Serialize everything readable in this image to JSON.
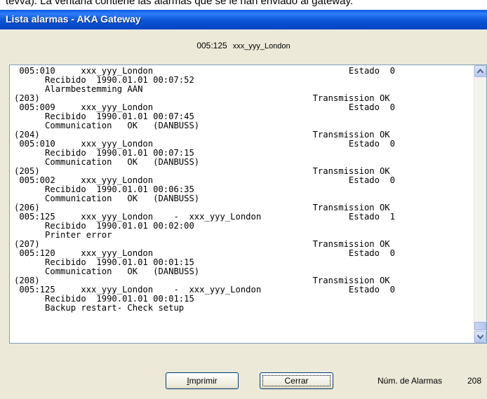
{
  "background_text": "tevva). La ventana contiene las alarmas que se le han enviado al gateway.",
  "window": {
    "title": "Lista alarmas - AKA Gateway"
  },
  "header": {
    "code": "005:125",
    "name": "xxx_yyy_London"
  },
  "alarm_lines": [
    " 005:010     xxx_yyy_London                                      Estado  0",
    "      Recibido  1990.01.01 00:07:52",
    "      Alarmbestemming AAN",
    "(203)                                                     Transmission OK",
    " 005:009     xxx_yyy_London                                      Estado  0",
    "      Recibido  1990.01.01 00:07:45",
    "      Communication   OK   (DANBUSS)",
    "(204)                                                     Transmission OK",
    " 005:010     xxx_yyy_London                                      Estado  0",
    "      Recibido  1990.01.01 00:07:15",
    "      Communication   OK   (DANBUSS)",
    "(205)                                                     Transmission OK",
    " 005:002     xxx_yyy_London                                      Estado  0",
    "      Recibido  1990.01.01 00:06:35",
    "      Communication   OK   (DANBUSS)",
    "(206)                                                     Transmission OK",
    " 005:125     xxx_yyy_London    -  xxx_yyy_London                 Estado  1",
    "      Recibido  1990.01.01 00:02:00",
    "      Printer error",
    "(207)                                                     Transmission OK",
    " 005:120     xxx_yyy_London                                      Estado  0",
    "      Recibido  1990.01.01 00:01:15",
    "      Communication   OK   (DANBUSS)",
    "(208)                                                     Transmission OK",
    " 005:125     xxx_yyy_London    -  xxx_yyy_London                 Estado  0",
    "      Recibido  1990.01.01 00:01:15",
    "      Backup restart- Check setup"
  ],
  "buttons": {
    "print_hotkey": "I",
    "print_rest": "mprimir",
    "close": "Cerrar"
  },
  "footer": {
    "count_label": "Núm. de Alarmas",
    "count_value": "208"
  },
  "icons": {
    "scroll_up": "arrow-up-icon",
    "scroll_down": "arrow-down-icon"
  },
  "colors": {
    "titlebar": "#0a54d8",
    "window_bg": "#ece9d8",
    "list_border": "#7f9db9"
  }
}
